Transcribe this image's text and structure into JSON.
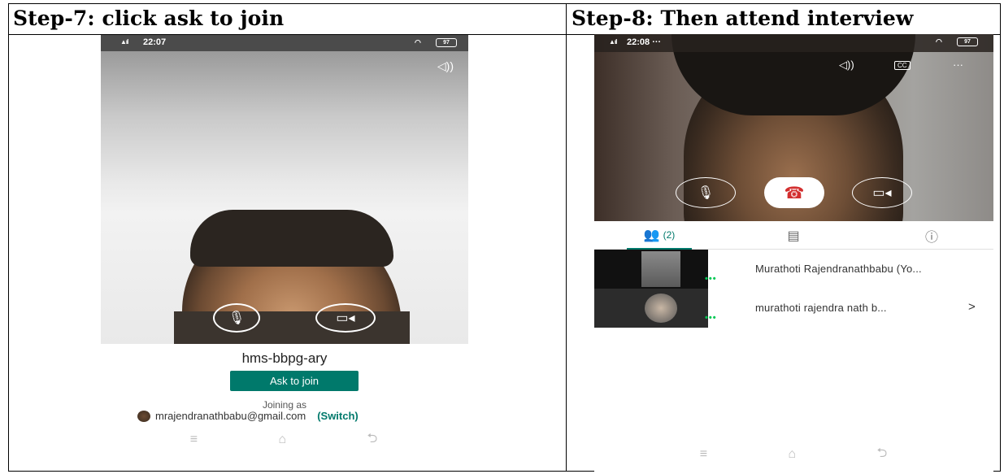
{
  "left_panel": {
    "heading": "Step-7: click ask to join",
    "phone": {
      "status_signal": "▲ıl",
      "status_time": "22:07",
      "battery": "97",
      "meeting_code": "hms-bbpg-ary",
      "ask_to_join_label": "Ask to join",
      "joining_as_label": "Joining as",
      "account_email": "mrajendranathbabu@gmail.com",
      "switch_label": "(Switch)"
    }
  },
  "right_panel": {
    "heading": "Step-8: Then attend interview",
    "phone": {
      "status_signal": "▲ıl",
      "status_time": "22:08 ···",
      "battery": "97",
      "people_tab_count": "(2)",
      "participants": [
        {
          "name": "Murathoti Rajendranathbabu (Yo...",
          "dots": "•••"
        },
        {
          "name": "murathoti rajendra nath b...",
          "dots": "•••",
          "chevron": ">"
        }
      ]
    }
  },
  "colors": {
    "accent": "#00796b",
    "end_call": "#d32f2f",
    "active_dots": "#00c853"
  },
  "icons": [
    "mic-icon",
    "camera-icon",
    "speaker-icon",
    "captions-icon",
    "more-icon",
    "end-call-icon",
    "people-icon",
    "chat-icon",
    "info-icon",
    "menu-icon",
    "home-icon",
    "back-icon",
    "wifi-icon",
    "battery-icon"
  ]
}
